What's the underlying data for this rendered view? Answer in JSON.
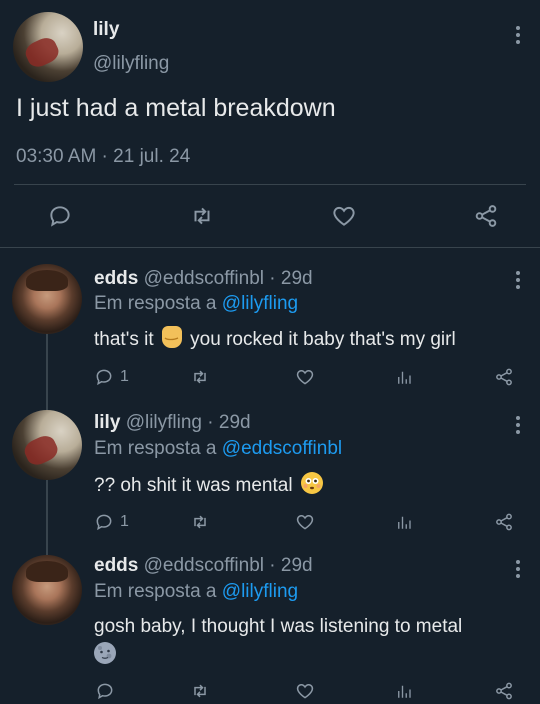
{
  "main_tweet": {
    "display_name": "lily",
    "handle": "@lilyfling",
    "text": "I just had a metal breakdown",
    "timestamp": "03:30 AM · 21 jul. 24"
  },
  "replies": [
    {
      "display_name": "edds",
      "handle": "@eddscoffinbl",
      "age": "· 29d",
      "reply_prefix": "Em resposta a",
      "reply_to": "@lilyfling",
      "text_before": "that's it",
      "emoji": "rock-on-hand",
      "text_after": "you rocked it baby that's my girl",
      "reply_count": "1"
    },
    {
      "display_name": "lily",
      "handle": "@lilyfling",
      "age": "· 29d",
      "reply_prefix": "Em resposta a",
      "reply_to": "@eddscoffinbl",
      "text": "?? oh shit it was mental",
      "emoji": "flushed-face",
      "reply_count": "1"
    },
    {
      "display_name": "edds",
      "handle": "@eddscoffinbl",
      "age": "· 29d",
      "reply_prefix": "Em resposta a",
      "reply_to": "@lilyfling",
      "text": "gosh baby, I thought I was listening to metal",
      "emoji": "new-moon-face"
    }
  ],
  "icons": {
    "reply": "reply-icon",
    "retweet": "retweet-icon",
    "like": "heart-icon",
    "views": "views-icon",
    "share": "share-icon",
    "more": "more-icon"
  },
  "colors": {
    "background": "#15202b",
    "text": "#e7e9ea",
    "muted": "#8b98a5",
    "link": "#1d9bf0",
    "divider": "#38444d"
  }
}
